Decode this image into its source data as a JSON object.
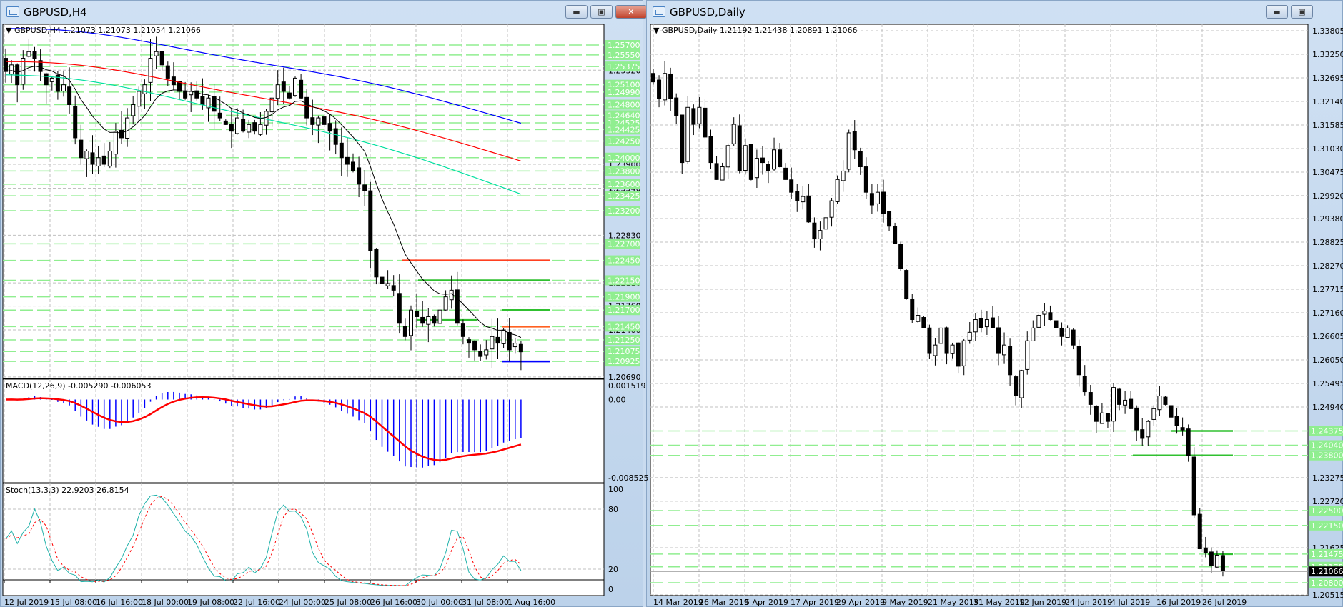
{
  "left_window": {
    "title": "GBPUSD,H4",
    "header": "GBPUSD,H4  1.21073 1.21073 1.21054 1.21066",
    "macd_header": "MACD(12,26,9) -0.005290 -0.006053",
    "stoch_header": "Stoch(13,3,3) 22.9203 26.8154",
    "price_axis": [
      "1.25320",
      "1.23900",
      "1.23540",
      "1.22830",
      "1.22110",
      "1.21760",
      "1.21400",
      "1.20690"
    ],
    "level_labels": [
      "1.25700",
      "1.25550",
      "1.25375",
      "1.25100",
      "1.24990",
      "1.24800",
      "1.24640",
      "1.24525",
      "1.24425",
      "1.24250",
      "1.24000",
      "1.23800",
      "1.23600",
      "1.23425",
      "1.23200",
      "1.22700",
      "1.22450",
      "1.22150",
      "1.21900",
      "1.21700",
      "1.21450",
      "1.21250",
      "1.21075",
      "1.20925"
    ],
    "macd_axis": [
      "0.001519",
      "0.00",
      "-0.008525"
    ],
    "stoch_axis": [
      "100",
      "80",
      "20",
      "0"
    ],
    "dates": [
      "12 Jul 2019",
      "15 Jul 08:00",
      "16 Jul 16:00",
      "18 Jul 00:00",
      "19 Jul 08:00",
      "22 Jul 16:00",
      "24 Jul 00:00",
      "25 Jul 08:00",
      "26 Jul 16:00",
      "30 Jul 00:00",
      "31 Jul 08:00",
      "1 Aug 16:00"
    ]
  },
  "right_window": {
    "title": "GBPUSD,Daily",
    "header": "GBPUSD,Daily  1.21192 1.21438 1.20891 1.21066",
    "price_axis": [
      "1.33805",
      "1.33250",
      "1.32695",
      "1.32140",
      "1.31585",
      "1.31030",
      "1.30475",
      "1.29920",
      "1.29380",
      "1.28825",
      "1.28270",
      "1.27715",
      "1.27160",
      "1.26605",
      "1.26050",
      "1.25495",
      "1.24940",
      "1.23275",
      "1.22720",
      "1.21625",
      "1.20515"
    ],
    "level_labels": [
      "1.24375",
      "1.24040",
      "1.23800",
      "1.22500",
      "1.22150",
      "1.21475",
      "1.21175",
      "1.20800"
    ],
    "current_price": "1.21066",
    "dates": [
      "14 Mar 2019",
      "26 Mar 2019",
      "5 Apr 2019",
      "17 Apr 2019",
      "29 Apr 2019",
      "9 May 2019",
      "21 May 2019",
      "31 May 2019",
      "12 Jun 2019",
      "24 Jun 2019",
      "4 Jul 2019",
      "16 Jul 2019",
      "26 Jul 2019"
    ]
  },
  "colors": {
    "level": "#90ee90",
    "label_bg": "#90ee90",
    "ma_blue": "#0000ff",
    "ma_red": "#ff0000",
    "ma_cyan": "#00e0a0",
    "ma_black": "#000000",
    "macd_hist": "#0000ff",
    "macd_signal": "#ff0000",
    "stoch_main": "#20b2aa",
    "stoch_signal": "#ff0000"
  },
  "chart_data": [
    {
      "type": "candlestick",
      "title": "GBPUSD,H4",
      "ylim": [
        1.2069,
        1.26
      ],
      "closes": [
        1.253,
        1.254,
        1.251,
        1.255,
        1.256,
        1.255,
        1.253,
        1.251,
        1.252,
        1.25,
        1.251,
        1.248,
        1.243,
        1.24,
        1.241,
        1.239,
        1.24,
        1.239,
        1.241,
        1.244,
        1.243,
        1.246,
        1.248,
        1.25,
        1.251,
        1.255,
        1.256,
        1.254,
        1.252,
        1.251,
        1.25,
        1.249,
        1.25,
        1.249,
        1.248,
        1.249,
        1.247,
        1.246,
        1.245,
        1.244,
        1.246,
        1.244,
        1.245,
        1.244,
        1.245,
        1.247,
        1.249,
        1.251,
        1.25,
        1.249,
        1.252,
        1.249,
        1.246,
        1.245,
        1.246,
        1.245,
        1.244,
        1.242,
        1.24,
        1.239,
        1.238,
        1.236,
        1.235,
        1.226,
        1.222,
        1.221,
        1.221,
        1.22,
        1.215,
        1.213,
        1.217,
        1.216,
        1.215,
        1.216,
        1.215,
        1.217,
        1.219,
        1.22,
        1.215,
        1.213,
        1.212,
        1.211,
        1.21,
        1.211,
        1.213,
        1.212,
        1.214,
        1.211,
        1.212,
        1.2107
      ],
      "moving_averages": [
        {
          "color": "blue",
          "from": 1.2595,
          "to": 1.2452
        },
        {
          "color": "red",
          "from": 1.2545,
          "to": 1.2395
        },
        {
          "color": "cyan",
          "from": 1.2525,
          "to": 1.2345
        }
      ],
      "levels": [
        1.257,
        1.2555,
        1.25375,
        1.251,
        1.2499,
        1.248,
        1.2464,
        1.24525,
        1.24425,
        1.2425,
        1.24,
        1.238,
        1.236,
        1.23425,
        1.232,
        1.227,
        1.2245,
        1.2215,
        1.219,
        1.217,
        1.2145,
        1.2125,
        1.21075,
        1.20925
      ],
      "solid_levels": [
        {
          "price": 1.2245,
          "color": "#ff4020"
        },
        {
          "price": 1.2215,
          "color": "#30c030"
        },
        {
          "price": 1.217,
          "color": "#30c030"
        },
        {
          "price": 1.2155,
          "color": "#30c030"
        },
        {
          "price": 1.2145,
          "color": "#ff6020"
        },
        {
          "price": 1.20925,
          "color": "#0000ff"
        }
      ]
    },
    {
      "type": "candlestick",
      "title": "GBPUSD,Daily",
      "ylim": [
        1.20515,
        1.33805
      ],
      "closes": [
        1.326,
        1.322,
        1.328,
        1.322,
        1.318,
        1.307,
        1.32,
        1.316,
        1.32,
        1.313,
        1.307,
        1.303,
        1.306,
        1.311,
        1.316,
        1.305,
        1.311,
        1.303,
        1.308,
        1.307,
        1.305,
        1.31,
        1.306,
        1.303,
        1.3,
        1.298,
        1.299,
        1.293,
        1.289,
        1.291,
        1.294,
        1.298,
        1.303,
        1.305,
        1.314,
        1.31,
        1.306,
        1.3,
        1.297,
        1.3,
        1.295,
        1.292,
        1.288,
        1.282,
        1.275,
        1.27,
        1.271,
        1.268,
        1.262,
        1.264,
        1.268,
        1.262,
        1.264,
        1.259,
        1.265,
        1.267,
        1.27,
        1.268,
        1.27,
        1.268,
        1.262,
        1.264,
        1.257,
        1.252,
        1.258,
        1.265,
        1.268,
        1.271,
        1.272,
        1.27,
        1.268,
        1.266,
        1.268,
        1.264,
        1.257,
        1.253,
        1.25,
        1.246,
        1.248,
        1.246,
        1.254,
        1.25,
        1.251,
        1.249,
        1.244,
        1.242,
        1.246,
        1.249,
        1.252,
        1.25,
        1.247,
        1.245,
        1.244,
        1.238,
        1.224,
        1.216,
        1.215,
        1.212,
        1.2145,
        1.2107
      ],
      "levels": [
        1.24375,
        1.2404,
        1.238,
        1.225,
        1.2215,
        1.21475,
        1.21175,
        1.208
      ],
      "solid_levels": [
        {
          "price": 1.24375,
          "color": "#30c030"
        },
        {
          "price": 1.238,
          "color": "#30c030"
        },
        {
          "price": 1.21475,
          "color": "#30c030"
        }
      ]
    }
  ]
}
